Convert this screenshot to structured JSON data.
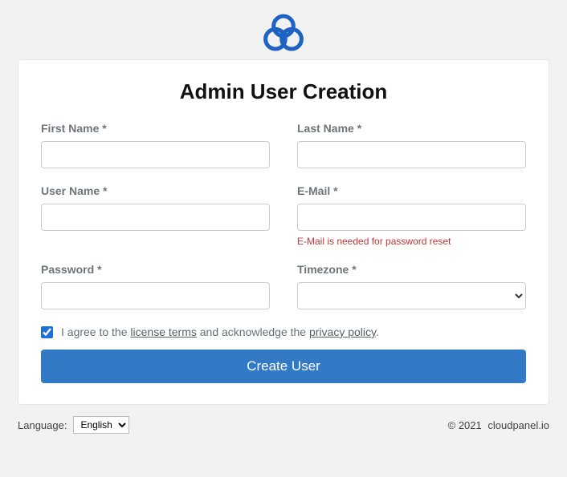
{
  "title": "Admin User Creation",
  "fields": {
    "first_name": {
      "label": "First Name *",
      "value": ""
    },
    "last_name": {
      "label": "Last Name *",
      "value": ""
    },
    "user_name": {
      "label": "User Name *",
      "value": ""
    },
    "email": {
      "label": "E-Mail *",
      "value": "",
      "hint": "E-Mail is needed for password reset"
    },
    "password": {
      "label": "Password *",
      "value": ""
    },
    "timezone": {
      "label": "Timezone *",
      "selected": ""
    }
  },
  "agree": {
    "checked": true,
    "text_pre": "I agree to the ",
    "license_link": "license terms",
    "text_mid": " and acknowledge the ",
    "privacy_link": "privacy policy",
    "text_post": "."
  },
  "submit_label": "Create User",
  "footer": {
    "language_label": "Language:",
    "language_selected": "English",
    "copyright": "© 2021",
    "site": "cloudpanel.io"
  },
  "colors": {
    "accent": "#3279c6",
    "hint_error": "#c23434"
  }
}
